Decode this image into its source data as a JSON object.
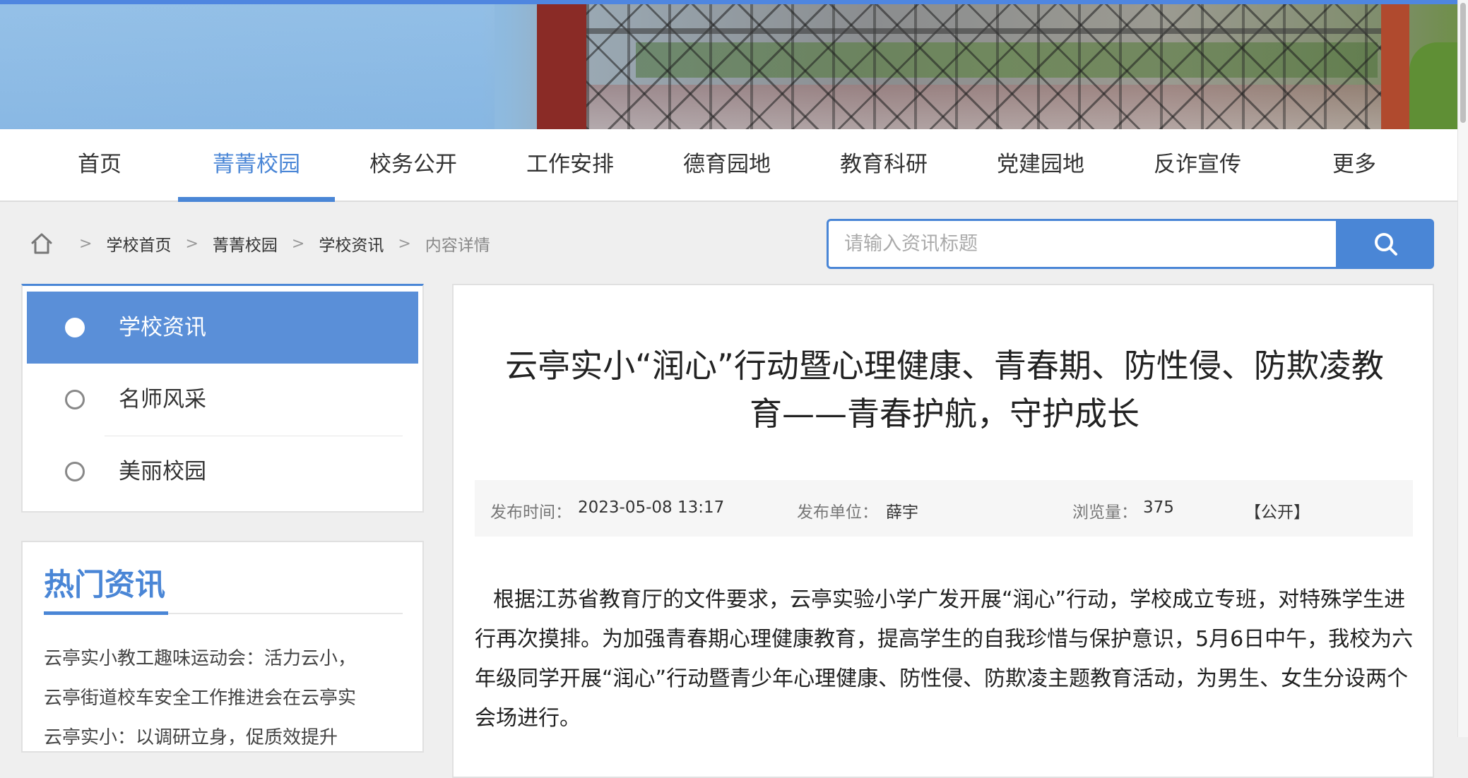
{
  "nav": {
    "items": [
      {
        "label": "首页"
      },
      {
        "label": "菁菁校园"
      },
      {
        "label": "校务公开"
      },
      {
        "label": "工作安排"
      },
      {
        "label": "德育园地"
      },
      {
        "label": "教育科研"
      },
      {
        "label": "党建园地"
      },
      {
        "label": "反诈宣传"
      },
      {
        "label": "更多"
      }
    ],
    "active_index": 1
  },
  "breadcrumb": {
    "items": [
      "学校首页",
      "菁菁校园",
      "学校资讯"
    ],
    "current": "内容详情",
    "separator": ">"
  },
  "search": {
    "placeholder": "请输入资讯标题",
    "value": ""
  },
  "sidebar": {
    "items": [
      {
        "label": "学校资讯",
        "active": true
      },
      {
        "label": "名师风采",
        "active": false
      },
      {
        "label": "美丽校园",
        "active": false
      }
    ]
  },
  "hot_news": {
    "title": "热门资讯",
    "items": [
      "云亭实小教工趣味运动会：活力云小，",
      "云亭街道校车安全工作推进会在云亭实",
      "云亭实小：以调研立身，促质效提升"
    ]
  },
  "article": {
    "title_line1": "云亭实小“润心”行动暨心理健康、青春期、防性侵、防欺凌教",
    "title_line2": "育——青春护航，守护成长",
    "meta": {
      "time_label": "发布时间：",
      "time_value": "2023-05-08 13:17",
      "unit_label": "发布单位：",
      "unit_value": "薛宇",
      "views_label": "浏览量：",
      "views_value": "375",
      "visibility": "【公开】"
    },
    "body": "根据江苏省教育厅的文件要求，云亭实验小学广发开展“润心”行动，学校成立专班，对特殊学生进行再次摸排。为加强青春期心理健康教育，提高学生的自我珍惜与保护意识，5月6日中午，我校为六年级同学开展“润心”行动暨青少年心理健康、防性侵、防欺凌主题教育活动，为男生、女生分设两个会场进行。"
  },
  "colors": {
    "accent": "#4a86d6",
    "sidebar_active": "#5a8fd8",
    "page_bg": "#efefef"
  }
}
